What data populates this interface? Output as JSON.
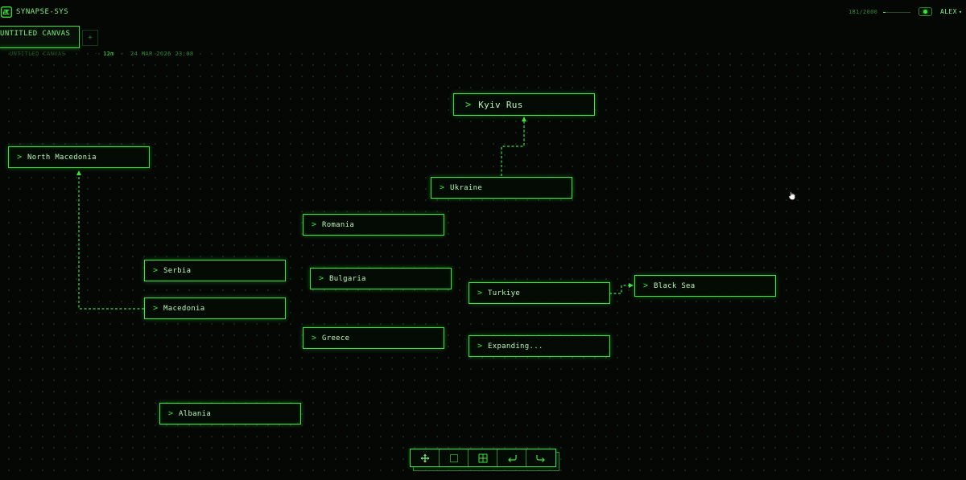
{
  "app": {
    "title": "SYNAPSE-SYS"
  },
  "header": {
    "counter": "181/2000",
    "usage_fraction": 0.09,
    "user": "ALEX",
    "user_chevron": "▾"
  },
  "tabs": [
    {
      "label": "UNTITLED CANVAS",
      "active": true
    }
  ],
  "tab_add": "+",
  "meta": {
    "canvas_name": "UNTITLED CANVAS",
    "separator": "·",
    "age": "12m",
    "date": "24 MAR 2026 23:08"
  },
  "nodes": {
    "kyiv": "Kyiv Rus",
    "north_macedonia": "North Macedonia",
    "ukraine": "Ukraine",
    "romania": "Romania",
    "serbia": "Serbia",
    "bulgaria": "Bulgaria",
    "turkiye": "Turkiye",
    "black_sea": "Black Sea",
    "macedonia": "Macedonia",
    "greece": "Greece",
    "expanding": "Expanding...",
    "albania": "Albania"
  },
  "node_chevron": ">",
  "toolbar": [
    "move-icon",
    "select-icon",
    "grid-icon",
    "undo-icon",
    "redo-icon"
  ],
  "colors": {
    "accent": "#39e63a",
    "text": "#b7f7b5",
    "dim": "#2c8a2e",
    "background": "#050705"
  }
}
